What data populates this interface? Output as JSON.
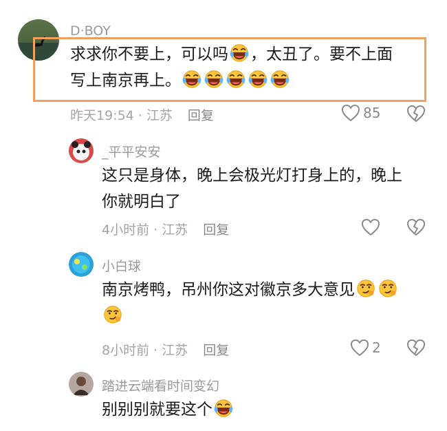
{
  "comments": [
    {
      "username": "D·BOY",
      "text_1": "求求你不要上，可以吗",
      "text_2": "，太丑了。要不上面",
      "text_3": "写上南京再上。",
      "time": "昨天19:54",
      "location": "江苏",
      "reply_label": "回复",
      "like_count": "85"
    },
    {
      "username": "_平平安安",
      "text_1": "这只是身体，晚上会极光灯打身上的，晚上",
      "text_2": "你就明白了",
      "time": "4小时前",
      "location": "江苏",
      "reply_label": "回复"
    },
    {
      "username": "小白球",
      "text_1": "南京烤鸭，吊州你这对徽京多大意见",
      "time": "8小时前",
      "location": "江苏",
      "reply_label": "回复",
      "like_count": "2"
    },
    {
      "username": "踏进云端看时间变幻",
      "text_1": "别别别就要这个"
    }
  ],
  "separator": " · ",
  "icons": {
    "like": "heart-outline-icon",
    "dislike": "broken-heart-icon",
    "laugh": "laugh-cry-emoji",
    "smirk": "smirk-emoji"
  },
  "colors": {
    "highlight": "#f0a15d",
    "meta": "#a5a5a5"
  }
}
